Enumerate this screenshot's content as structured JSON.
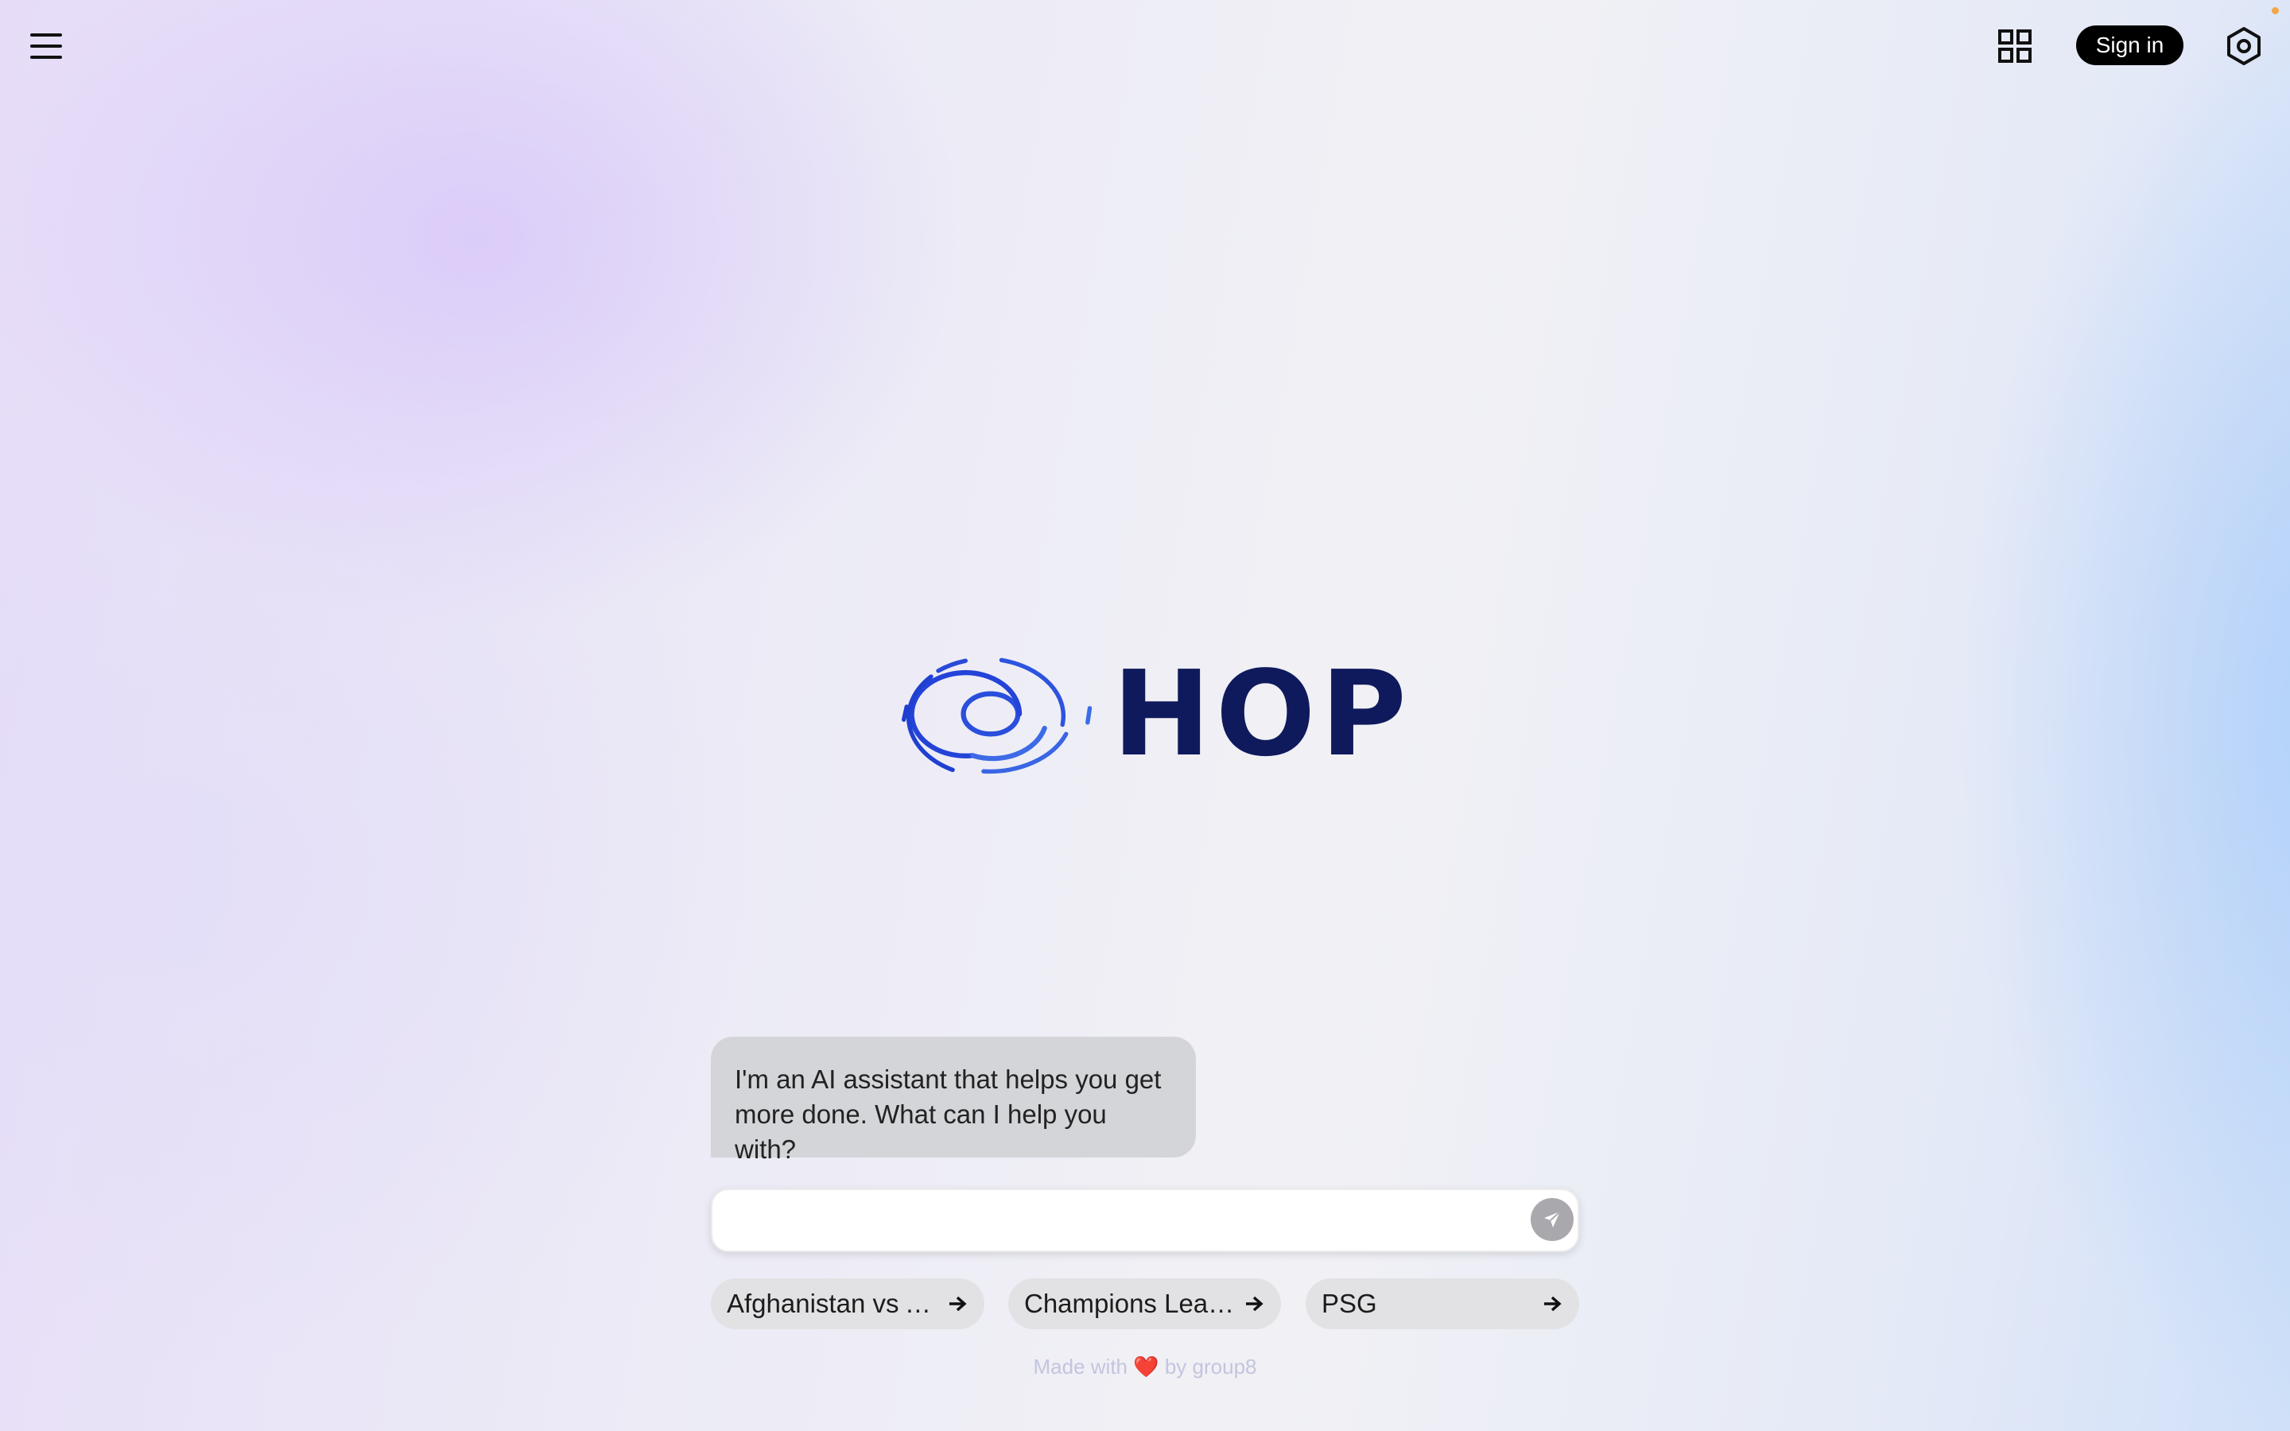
{
  "header": {
    "menu_icon": "hamburger-menu-icon",
    "apps_icon": "grid-apps-icon",
    "sign_in_label": "Sign in",
    "settings_icon": "hexagon-settings-icon"
  },
  "logo": {
    "text": "HOP",
    "icon": "spiral-orbit-logo-icon",
    "text_color": "#0f1a5c",
    "icon_color": "#2443d8"
  },
  "chat": {
    "assistant_message": "I'm an AI assistant that helps you get more done. What can I help you with?",
    "input_value": "",
    "send_icon": "paper-plane-send-icon"
  },
  "suggestions": [
    {
      "label": "Afghanistan vs A…",
      "icon": "arrow-right-icon"
    },
    {
      "label": "Champions Lea…",
      "icon": "arrow-right-icon"
    },
    {
      "label": "PSG",
      "icon": "arrow-right-icon"
    }
  ],
  "footer": {
    "prefix": "Made with",
    "heart": "❤️",
    "suffix": "by group8"
  },
  "colors": {
    "sign_in_bg": "#000000",
    "notification_dot": "#f4a64a",
    "bubble_bg": "#d4d5d9",
    "chip_bg": "#e2e2e4"
  }
}
